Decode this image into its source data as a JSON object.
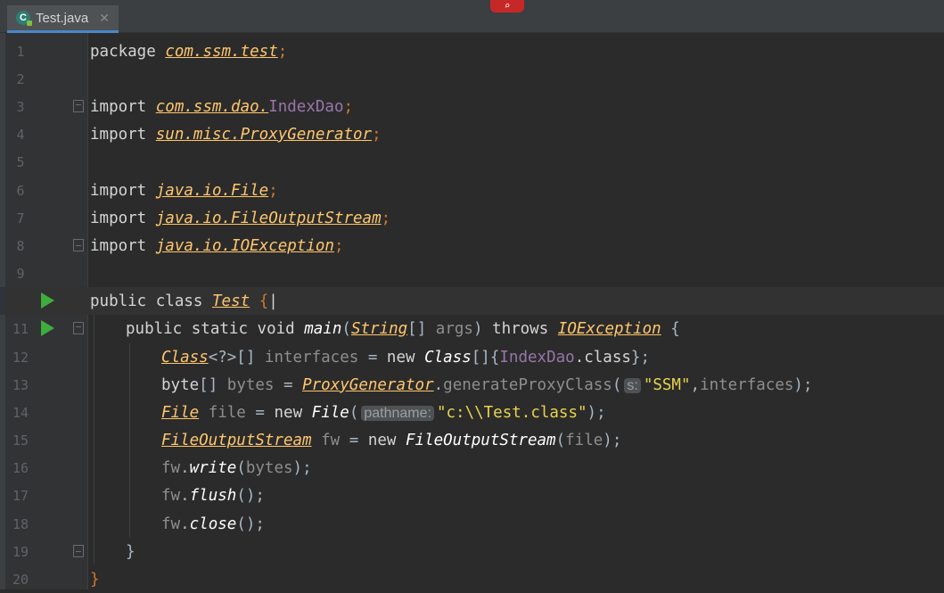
{
  "tab": {
    "filename": "Test.java",
    "icon": "java-class-icon",
    "close": "✕"
  },
  "colors": {
    "background": "#2b2b2b",
    "keyword": "#cc7832",
    "string": "#e8d44d",
    "run": "#3ead3e"
  },
  "lines": [
    {
      "n": "1",
      "text": "package com.ssm.test;"
    },
    {
      "n": "2",
      "text": ""
    },
    {
      "n": "3",
      "text": "import com.ssm.dao.IndexDao;"
    },
    {
      "n": "4",
      "text": "import sun.misc.ProxyGenerator;"
    },
    {
      "n": "5",
      "text": ""
    },
    {
      "n": "6",
      "text": "import java.io.File;"
    },
    {
      "n": "7",
      "text": "import java.io.FileOutputStream;"
    },
    {
      "n": "8",
      "text": "import java.io.IOException;"
    },
    {
      "n": "9",
      "text": ""
    },
    {
      "n": "",
      "text": "public class Test {"
    },
    {
      "n": "11",
      "text": "    public static void main(String[] args) throws IOException {"
    },
    {
      "n": "12",
      "text": "        Class<?>[] interfaces = new Class[]{IndexDao.class};"
    },
    {
      "n": "13",
      "text": "        byte[] bytes = ProxyGenerator.generateProxyClass( s: \"SSM\",interfaces);"
    },
    {
      "n": "14",
      "text": "        File file = new File( pathname: \"c:\\\\Test.class\");"
    },
    {
      "n": "15",
      "text": "        FileOutputStream fw = new FileOutputStream(file);"
    },
    {
      "n": "16",
      "text": "        fw.write(bytes);"
    },
    {
      "n": "17",
      "text": "        fw.flush();"
    },
    {
      "n": "18",
      "text": "        fw.close();"
    },
    {
      "n": "19",
      "text": "    }"
    },
    {
      "n": "20",
      "text": "}"
    }
  ],
  "tokens": {
    "package": "package",
    "import": "import",
    "pkg_test": "com.ssm.test",
    "semi": ";",
    "pkg_dao": "com.ssm.dao.",
    "indexdao": "IndexDao",
    "pkg_sun": "sun.misc.ProxyGenerator",
    "pkg_file": "java.io.File",
    "pkg_fos": "java.io.FileOutputStream",
    "pkg_ioe": "java.io.IOException",
    "public": "public",
    "class": "class",
    "static": "static",
    "void": "void",
    "main": "main",
    "string": "String",
    "brackets": "[]",
    "args": "args",
    "throws": "throws",
    "ioexception": "IOException",
    "open_brace": "{",
    "close_brace": "}",
    "test": "Test",
    "class_type": "Class",
    "generic": "<?>",
    "interfaces": "interfaces",
    "eq": "=",
    "new": "new",
    "class_kw": ".class",
    "byte": "byte",
    "bytes": "bytes",
    "proxygen": "ProxyGenerator",
    "gen_method": "generateProxyClass",
    "hint_s": "s:",
    "ssm_str": "\"SSM\"",
    "file_type": "File",
    "file_var": "file",
    "hint_pathname": "pathname:",
    "path_str": "\"c:\\\\Test.class\"",
    "fos_type": "FileOutputStream",
    "fw": "fw",
    "write": "write",
    "flush": "flush",
    "close": "close"
  },
  "gutter": {
    "run_icon": "run-icon",
    "fold_icon": "fold-icon"
  }
}
